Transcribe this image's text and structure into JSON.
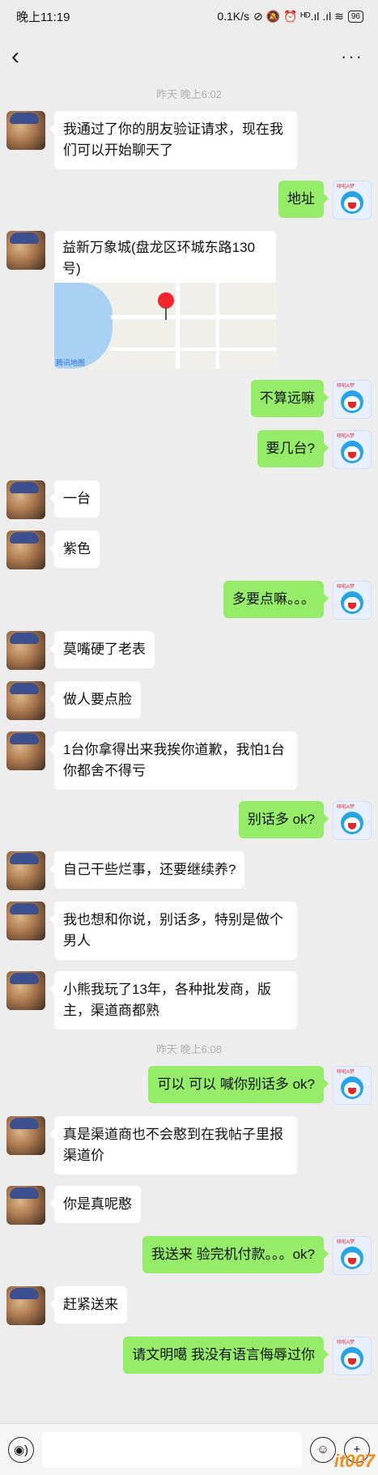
{
  "status_bar": {
    "time": "晚上11:19",
    "speed": "0.1K/s",
    "icons_text": "⊘ 🔕 ⏰ ᴴᴰ.ıl .ıl ≋",
    "battery": "96"
  },
  "nav": {
    "back_icon": "‹",
    "more_icon": "···"
  },
  "timestamps": [
    "昨天 晚上6:02",
    "昨天 晚上6:08"
  ],
  "messages": [
    {
      "side": "left",
      "text": "我通过了你的朋友验证请求，现在我们可以开始聊天了"
    },
    {
      "side": "right",
      "text": "地址"
    },
    {
      "side": "left",
      "type": "location",
      "text": "益新万象城(盘龙区环城东路130号)"
    },
    {
      "side": "right",
      "text": "不算远嘛"
    },
    {
      "side": "right",
      "text": "要几台?"
    },
    {
      "side": "left",
      "text": "一台"
    },
    {
      "side": "left",
      "text": "紫色"
    },
    {
      "side": "right",
      "text": "多要点嘛。。。"
    },
    {
      "side": "left",
      "text": "莫嘴硬了老表"
    },
    {
      "side": "left",
      "text": "做人要点脸"
    },
    {
      "side": "left",
      "text": "1台你拿得出来我挨你道歉，我怕1台你都舍不得亏"
    },
    {
      "side": "right",
      "text": "别话多   ok?"
    },
    {
      "side": "left",
      "text": "自己干些烂事，还要继续养?"
    },
    {
      "side": "left",
      "text": "我也想和你说，别话多，特别是做个男人"
    },
    {
      "side": "left",
      "text": "小熊我玩了13年，各种批发商，版主，渠道商都熟"
    },
    {
      "side": "right",
      "text": "可以  可以  喊你别话多  ok?"
    },
    {
      "side": "left",
      "text": "真是渠道商也不会憨到在我帖子里报渠道价"
    },
    {
      "side": "left",
      "text": "你是真呢憨"
    },
    {
      "side": "right",
      "text": "我送来  验完机付款。。。ok?"
    },
    {
      "side": "left",
      "text": "赶紧送来"
    },
    {
      "side": "right",
      "text": "请文明噶  我没有语言侮辱过你"
    }
  ],
  "map_logo": "腾讯地图",
  "dora_caption": "哆啦A梦",
  "input": {
    "voice_icon": "◉)",
    "emoji_icon": "☺",
    "plus_icon": "+"
  },
  "watermark": "it007"
}
